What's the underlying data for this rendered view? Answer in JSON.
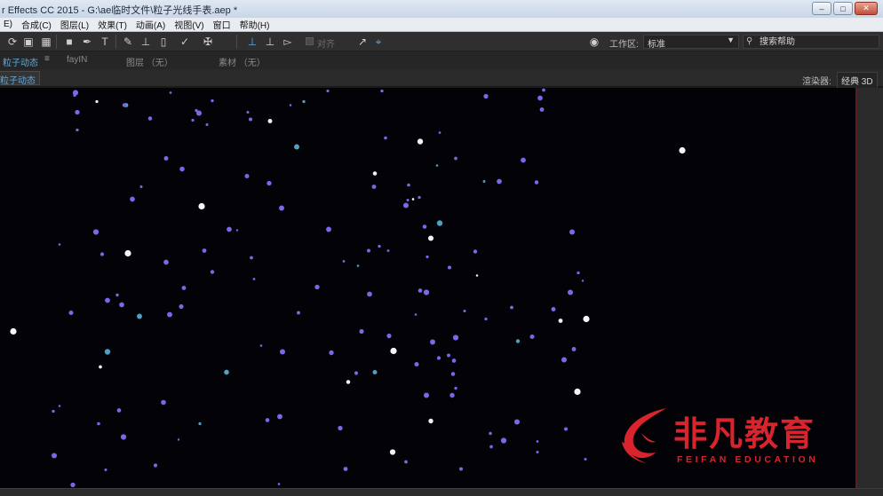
{
  "window": {
    "title": "r Effects CC 2015 - G:\\ae临时文件\\粒子光线手表.aep *",
    "minimize_icon": "minimize-icon",
    "maximize_icon": "maximize-icon",
    "close_icon": "close-icon"
  },
  "menu": {
    "items": [
      "E)",
      "合成(C)",
      "图层(L)",
      "效果(T)",
      "动画(A)",
      "视图(V)",
      "窗口",
      "帮助(H)"
    ]
  },
  "toolbar": {
    "align_label": "对齐",
    "workspace_label": "工作区:",
    "workspace_value": "标准",
    "search_placeholder": "搜索帮助",
    "tools": [
      "rotation-tool-icon",
      "camera-tool-icon",
      "pan-behind-tool-icon",
      "rectangle-tool-icon",
      "pen-tool-icon",
      "type-tool-icon",
      "brush-tool-icon",
      "clone-stamp-tool-icon",
      "eraser-tool-icon",
      "roto-brush-tool-icon",
      "puppet-pin-tool-icon",
      "local-axis-icon",
      "world-axis-icon",
      "view-axis-icon"
    ]
  },
  "panels": {
    "tabs": [
      "粒子动态",
      "fayIN",
      "图层 （无）",
      "素材 （无）"
    ]
  },
  "viewer": {
    "comp_tab": "粒子动态",
    "renderer_label": "渲染器:",
    "renderer_value": "经典 3D"
  },
  "watermark": {
    "name": "非凡教育",
    "subtitle": "FEIFAN EDUCATION",
    "color": "#d8242d"
  },
  "colors": {
    "accent": "#63a8d9",
    "viewer_bg": "#030206",
    "streak_purple": "#6a58d8",
    "streak_white": "#e6e2f0"
  }
}
